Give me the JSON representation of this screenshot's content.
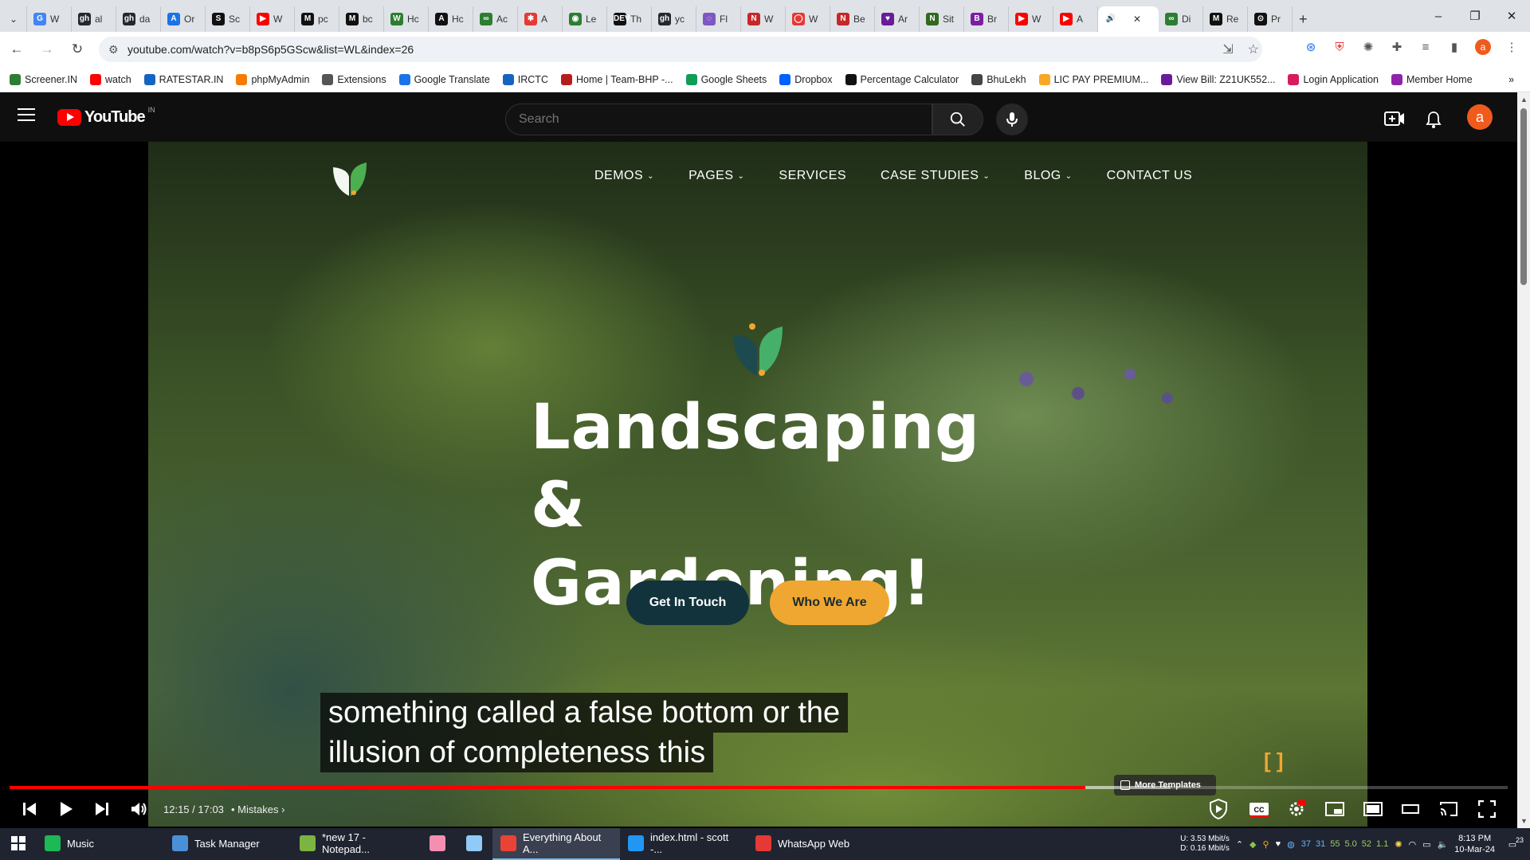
{
  "browser": {
    "tabs": [
      {
        "label": "W",
        "favicon": "G",
        "color": "#4285f4"
      },
      {
        "label": "al",
        "favicon": "gh",
        "color": "#24292f"
      },
      {
        "label": "da",
        "favicon": "gh",
        "color": "#24292f"
      },
      {
        "label": "Or",
        "favicon": "A",
        "color": "#1a73e8"
      },
      {
        "label": "Sc",
        "favicon": "S",
        "color": "#111"
      },
      {
        "label": "W",
        "favicon": "▶",
        "color": "#ff0000"
      },
      {
        "label": "pc",
        "favicon": "M",
        "color": "#111"
      },
      {
        "label": "bc",
        "favicon": "M",
        "color": "#111"
      },
      {
        "label": "Hc",
        "favicon": "W",
        "color": "#2e7d32"
      },
      {
        "label": "Hc",
        "favicon": "A",
        "color": "#111"
      },
      {
        "label": "Ac",
        "favicon": "∞",
        "color": "#2e7d32"
      },
      {
        "label": "A",
        "favicon": "✱",
        "color": "#e53935"
      },
      {
        "label": "Le",
        "favicon": "◉",
        "color": "#2e7d32"
      },
      {
        "label": "Th",
        "favicon": "DEV",
        "color": "#111"
      },
      {
        "label": "yc",
        "favicon": "gh",
        "color": "#24292f"
      },
      {
        "label": "Fl",
        "favicon": "◌",
        "color": "#7e57c2"
      },
      {
        "label": "W",
        "favicon": "N",
        "color": "#c62828"
      },
      {
        "label": "W",
        "favicon": "◯",
        "color": "#e53935"
      },
      {
        "label": "Be",
        "favicon": "N",
        "color": "#c62828"
      },
      {
        "label": "Ar",
        "favicon": "♥",
        "color": "#6a1b9a"
      },
      {
        "label": "Sit",
        "favicon": "N",
        "color": "#33691e"
      },
      {
        "label": "Br",
        "favicon": "B",
        "color": "#7b1fa2"
      },
      {
        "label": "W",
        "favicon": "▶",
        "color": "#ff0000"
      },
      {
        "label": "A",
        "favicon": "▶",
        "color": "#ff0000"
      },
      {
        "label": "",
        "favicon": "🔊",
        "color": "#ffffff",
        "active": true
      },
      {
        "label": "Di",
        "favicon": "∞",
        "color": "#2e7d32"
      },
      {
        "label": "Re",
        "favicon": "M",
        "color": "#111"
      },
      {
        "label": "Pr",
        "favicon": "⊙",
        "color": "#111"
      }
    ],
    "new_tab": "+",
    "url": "youtube.com/watch?v=b8pS6p5GScw&list=WL&index=26",
    "bookmarks": [
      {
        "label": "Screener.IN",
        "color": "#2e7d32"
      },
      {
        "label": "watch",
        "color": "#ff0000"
      },
      {
        "label": "RATESTAR.IN",
        "color": "#1565c0"
      },
      {
        "label": "phpMyAdmin",
        "color": "#f57c00"
      },
      {
        "label": "Extensions",
        "color": "#555"
      },
      {
        "label": "Google Translate",
        "color": "#1a73e8"
      },
      {
        "label": "IRCTC",
        "color": "#1565c0"
      },
      {
        "label": "Home | Team-BHP -...",
        "color": "#b71c1c"
      },
      {
        "label": "Google Sheets",
        "color": "#0f9d58"
      },
      {
        "label": "Dropbox",
        "color": "#0061fe"
      },
      {
        "label": "Percentage Calculator",
        "color": "#111"
      },
      {
        "label": "BhuLekh",
        "color": "#444"
      },
      {
        "label": "LIC PAY PREMIUM...",
        "color": "#f9a825"
      },
      {
        "label": "View Bill: Z21UK552...",
        "color": "#6a1b9a"
      },
      {
        "label": "Login Application",
        "color": "#d81b60"
      },
      {
        "label": "Member Home",
        "color": "#8e24aa"
      }
    ],
    "bookmarks_overflow": "»"
  },
  "youtube": {
    "logo_text": "YouTube",
    "country_code": "IN",
    "search_placeholder": "Search",
    "avatar_letter": "a",
    "avatar_color": "#ef5b1d"
  },
  "video": {
    "site_nav": [
      {
        "label": "DEMOS",
        "has_menu": true
      },
      {
        "label": "PAGES",
        "has_menu": true
      },
      {
        "label": "SERVICES",
        "has_menu": false
      },
      {
        "label": "CASE STUDIES",
        "has_menu": true
      },
      {
        "label": "BLOG",
        "has_menu": true
      },
      {
        "label": "CONTACT US",
        "has_menu": false
      }
    ],
    "hero_title_line1": "Landscaping",
    "hero_title_line2": "& Gardening!",
    "btn_primary": "Get In Touch",
    "btn_secondary": "Who We Are",
    "more_templates": "More Templates",
    "captions": [
      "something called a false bottom or the",
      "illusion of completeness this"
    ],
    "time_display": "12:15 / 17:03",
    "chapter": "Mistakes",
    "progress": 0.718,
    "buffered": 0.775,
    "accent": "#ff0000",
    "brand_primary": "#12333c",
    "brand_secondary": "#f0a731"
  },
  "taskbar": {
    "apps": [
      {
        "label": "Music",
        "icon": "music-icon",
        "color": "#1db954"
      },
      {
        "label": "Task Manager",
        "icon": "task-manager-icon",
        "color": "#4a90d9"
      },
      {
        "label": "*new 17 - Notepad...",
        "icon": "notepad-icon",
        "color": "#7cb342"
      },
      {
        "label": "",
        "icon": "pig-icon",
        "color": "#f48fb1"
      },
      {
        "label": "",
        "icon": "file-icon",
        "color": "#90caf9"
      },
      {
        "label": "Everything About A...",
        "icon": "chrome-icon",
        "color": "#ea4335",
        "active": true
      },
      {
        "label": "index.html - scott -...",
        "icon": "vscode-icon",
        "color": "#2196f3"
      },
      {
        "label": "WhatsApp Web",
        "icon": "whatsapp-icon",
        "color": "#e53935"
      }
    ],
    "net_up_label": "U:",
    "net_up": "3.53 Mbit/s",
    "net_down_label": "D:",
    "net_down": "0.16 Mbit/s",
    "tray_numbers": [
      "37",
      "31",
      "55",
      "5.0",
      "52",
      "1.1"
    ],
    "time": "8:13 PM",
    "date": "10-Mar-24",
    "notifications": "23"
  }
}
